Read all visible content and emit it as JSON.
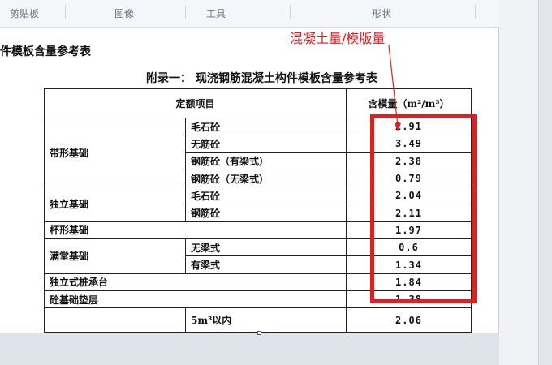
{
  "ribbon": {
    "groups": [
      "剪贴板",
      "图像",
      "工具",
      "形状"
    ]
  },
  "doc": {
    "title": "件模板含量参考表",
    "appendix": "附录一：  现浇钢筋混凝土构件模板含量参考表"
  },
  "table": {
    "header_item": "定额项目",
    "header_value": "含模量（m²/m³）",
    "rows": [
      {
        "group": "带形基础",
        "item": "毛石砼",
        "value": "2.91"
      },
      {
        "group": "",
        "item": "无筋砼",
        "value": "3.49"
      },
      {
        "group": "",
        "item": "钢筋砼（有梁式）",
        "value": "2.38"
      },
      {
        "group": "",
        "item": "钢筋砼（无梁式）",
        "value": "0.79"
      },
      {
        "group": "独立基础",
        "item": "毛石砼",
        "value": "2.04"
      },
      {
        "group": "",
        "item": "钢筋砼",
        "value": "2.11"
      },
      {
        "group": "杯形基础",
        "item": "",
        "value": "1.97"
      },
      {
        "group": "满堂基础",
        "item": "无梁式",
        "value": "0.6"
      },
      {
        "group": "",
        "item": "有梁式",
        "value": "1.34"
      },
      {
        "group": "独立式桩承台",
        "item": "",
        "value": "1.84"
      },
      {
        "group": "砼基础垫层",
        "item": "",
        "value": "1.38"
      },
      {
        "group": "",
        "item": "5m³以内",
        "value": "2.06"
      }
    ]
  },
  "annotation": {
    "text": "混凝土量/模版量",
    "color": "#e21f1f"
  }
}
